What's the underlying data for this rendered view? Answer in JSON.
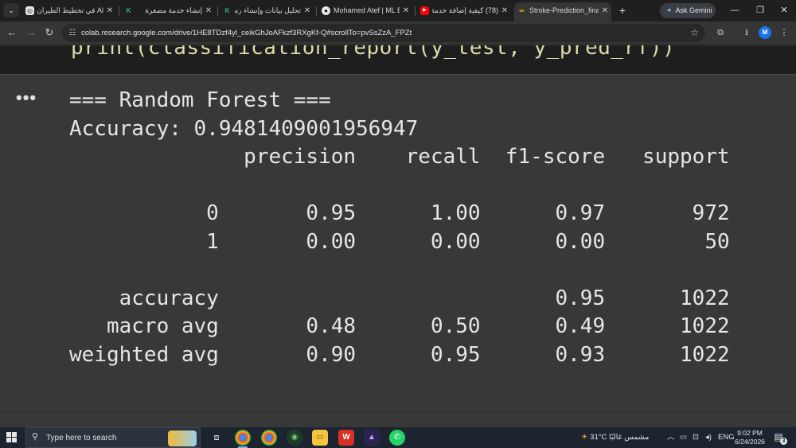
{
  "browser": {
    "tabs": [
      {
        "title": "Al في تخطيط الطيران",
        "icon": "openai-icon",
        "active": false
      },
      {
        "title": "إنشاء خدمة مصغرة",
        "icon": "kilo-icon",
        "active": false
      },
      {
        "title": "تحليل بيانات وإنشاء رس",
        "icon": "kilo-icon",
        "active": false
      },
      {
        "title": "Mohamed Atef | ML E",
        "icon": "github-icon",
        "active": false
      },
      {
        "title": "(78) كيفية إضافة خدمة",
        "icon": "youtube-icon",
        "active": false
      },
      {
        "title": "Stroke-Prediction_fina",
        "icon": "colab-icon",
        "active": true
      }
    ],
    "new_tab": "+",
    "gemini_label": "Ask Gemini",
    "url": "colab.research.google.com/drive/1HE8TDzf4yl_ceikGhJoAFkzf3RXgKf-Q#scrollTo=pvSsZzA_FPZt",
    "profile_initial": "M"
  },
  "notebook": {
    "code_line": "print(classification_report(y_test, y_pred_rf))",
    "output_menu": "•••",
    "output_lines": [
      "=== Random Forest ===",
      "Accuracy: 0.9481409001956947",
      "              precision    recall  f1-score   support",
      "",
      "           0       0.95      1.00      0.97       972",
      "           1       0.00      0.00      0.00        50",
      "",
      "    accuracy                           0.95      1022",
      "   macro avg       0.48      0.50      0.49      1022",
      "weighted avg       0.90      0.95      0.93      1022"
    ]
  },
  "taskbar": {
    "search_placeholder": "Type here to search",
    "weather_temp": "31°C",
    "weather_desc": "مشمس غالبًا",
    "lang": "ENG",
    "time": "9:02 PM",
    "date": "6/24/2026",
    "notification_count": "3"
  },
  "colors": {
    "accent": "#1a73e8",
    "code_yellow": "#dcdcaa",
    "paren_gold": "#ffd700"
  }
}
